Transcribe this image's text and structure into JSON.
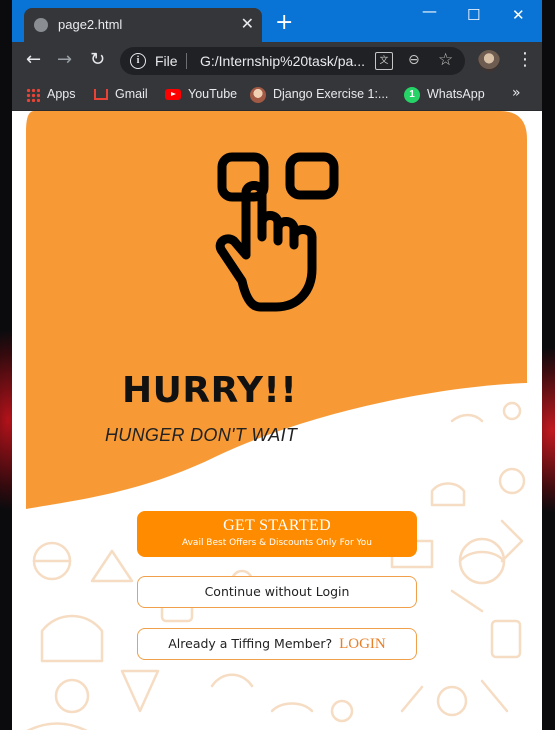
{
  "browser": {
    "tab_title": "page2.html",
    "new_tab_symbol": "+",
    "url_scheme_label": "File",
    "url": "G:/Internship%20task/pa...",
    "bookmarks": [
      {
        "label": "Apps",
        "icon": "apps-grid-icon"
      },
      {
        "label": "Gmail",
        "icon": "gmail-icon"
      },
      {
        "label": "YouTube",
        "icon": "youtube-icon"
      },
      {
        "label": "Django Exercise 1:...",
        "icon": "django-avatar-icon"
      },
      {
        "label": "WhatsApp",
        "icon": "whatsapp-icon"
      }
    ],
    "whatsapp_badge": "1"
  },
  "page": {
    "headline": "HURRY!!",
    "tagline": "HUNGER DON'T WAIT",
    "get_started": {
      "title": "GET STARTED",
      "subtitle": "Avail Best Offers & Discounts Only For You"
    },
    "continue_label": "Continue without Login",
    "member_prompt": "Already a Tiffing Member?",
    "login_label": "LOGIN"
  },
  "colors": {
    "chrome_titlebar": "#0a74d6",
    "chrome_dark": "#35363a",
    "accent_orange": "#f79a36",
    "button_orange": "#ff8c00",
    "doodle": "#f6dcc2"
  }
}
